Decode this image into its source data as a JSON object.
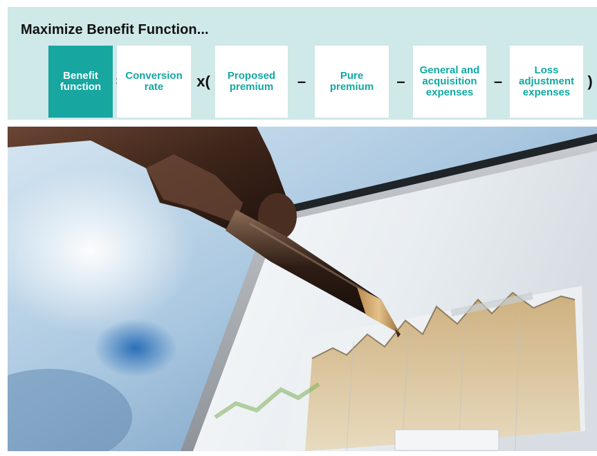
{
  "formula": {
    "title": "Maximize Benefit Function...",
    "terms": {
      "benefit_function": "Benefit function",
      "conversion_rate": "Conversion rate",
      "proposed_premium": "Proposed premium",
      "pure_premium": "Pure premium",
      "general_acquisition_expenses": "General and acquisition expenses",
      "loss_adjustment_expenses": "Loss adjustment expenses"
    },
    "operators": {
      "equals": "=",
      "times_open": "x(",
      "minus": "–",
      "close": ")"
    }
  },
  "colors": {
    "panel_background": "#cfe8e8",
    "accent_teal": "#17a6a0",
    "term_text": "#11a8a3"
  },
  "photo": {
    "subject": "hand-with-pen-pointing-at-chart-on-screen"
  }
}
